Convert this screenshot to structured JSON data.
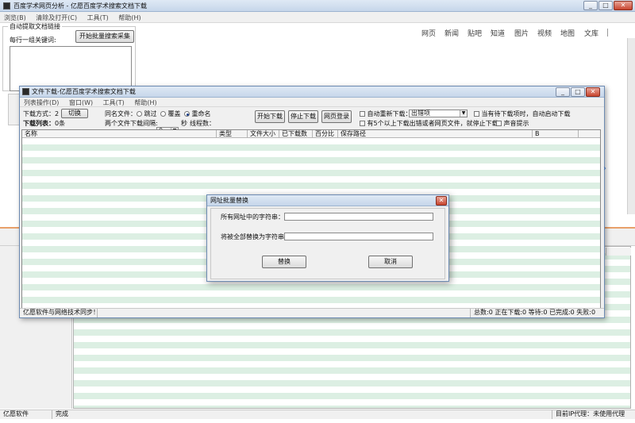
{
  "main_window": {
    "title": "百度学术网页分析 - 亿愿百度学术搜索文档下载",
    "menu": [
      "浏览(B)",
      "清除及打开(C)",
      "工具(T)",
      "帮助(H)"
    ],
    "group_title": "自动提取文档链接",
    "keyword_label": "每行一组关键词:",
    "start_button": "开始批量搜索采集",
    "nav_links": [
      "网页",
      "新闻",
      "贴吧",
      "知道",
      "图片",
      "视频",
      "地图",
      "文库"
    ],
    "status": {
      "left": "亿愿软件",
      "mid": "完成",
      "right": "目前IP代理：未使用代理"
    }
  },
  "download_window": {
    "title": "文件下载-亿愿百度学术搜索文档下载",
    "menu": [
      "列表操作(D)",
      "窗口(W)",
      "工具(T)",
      "帮助(H)"
    ],
    "mode_label": "下载方式：2",
    "switch_button": "切换",
    "list_label": "下载列表：",
    "list_count": "0条",
    "rename_label": "同名文件：",
    "rename_options": [
      "跳过",
      "覆盖",
      "重命名"
    ],
    "rename_selected": 2,
    "interval_label": "两个文件下载间隔:",
    "interval_value": "0",
    "interval_unit": "秒",
    "threads_label": "线程数：",
    "threads_value": "3",
    "start_button": "开始下载",
    "stop_button": "停止下载",
    "login_button": "网页登录",
    "auto_retry_label": "自动重新下载：",
    "auto_retry_value": "出错项",
    "auto_start_label": "当有待下载项时，自动启动下载",
    "stop_error_label": "有5个以上下载出错或者网页文件，就停止下载",
    "sound_label": "声音提示",
    "columns": [
      "名称",
      "类型",
      "文件大小",
      "已下载数",
      "百分比",
      "保存路径",
      "B"
    ],
    "status_left": "亿愿软件与网络技术同步！",
    "status_right": "总数:0  正在下载:0  等待:0  已完成:0  失败:0"
  },
  "dialog": {
    "title": "网址批量替换",
    "find_label": "所有网址中的字符串：",
    "replace_label": "将被全部替换为字符串：",
    "replace_button": "替换",
    "cancel_button": "取消"
  }
}
